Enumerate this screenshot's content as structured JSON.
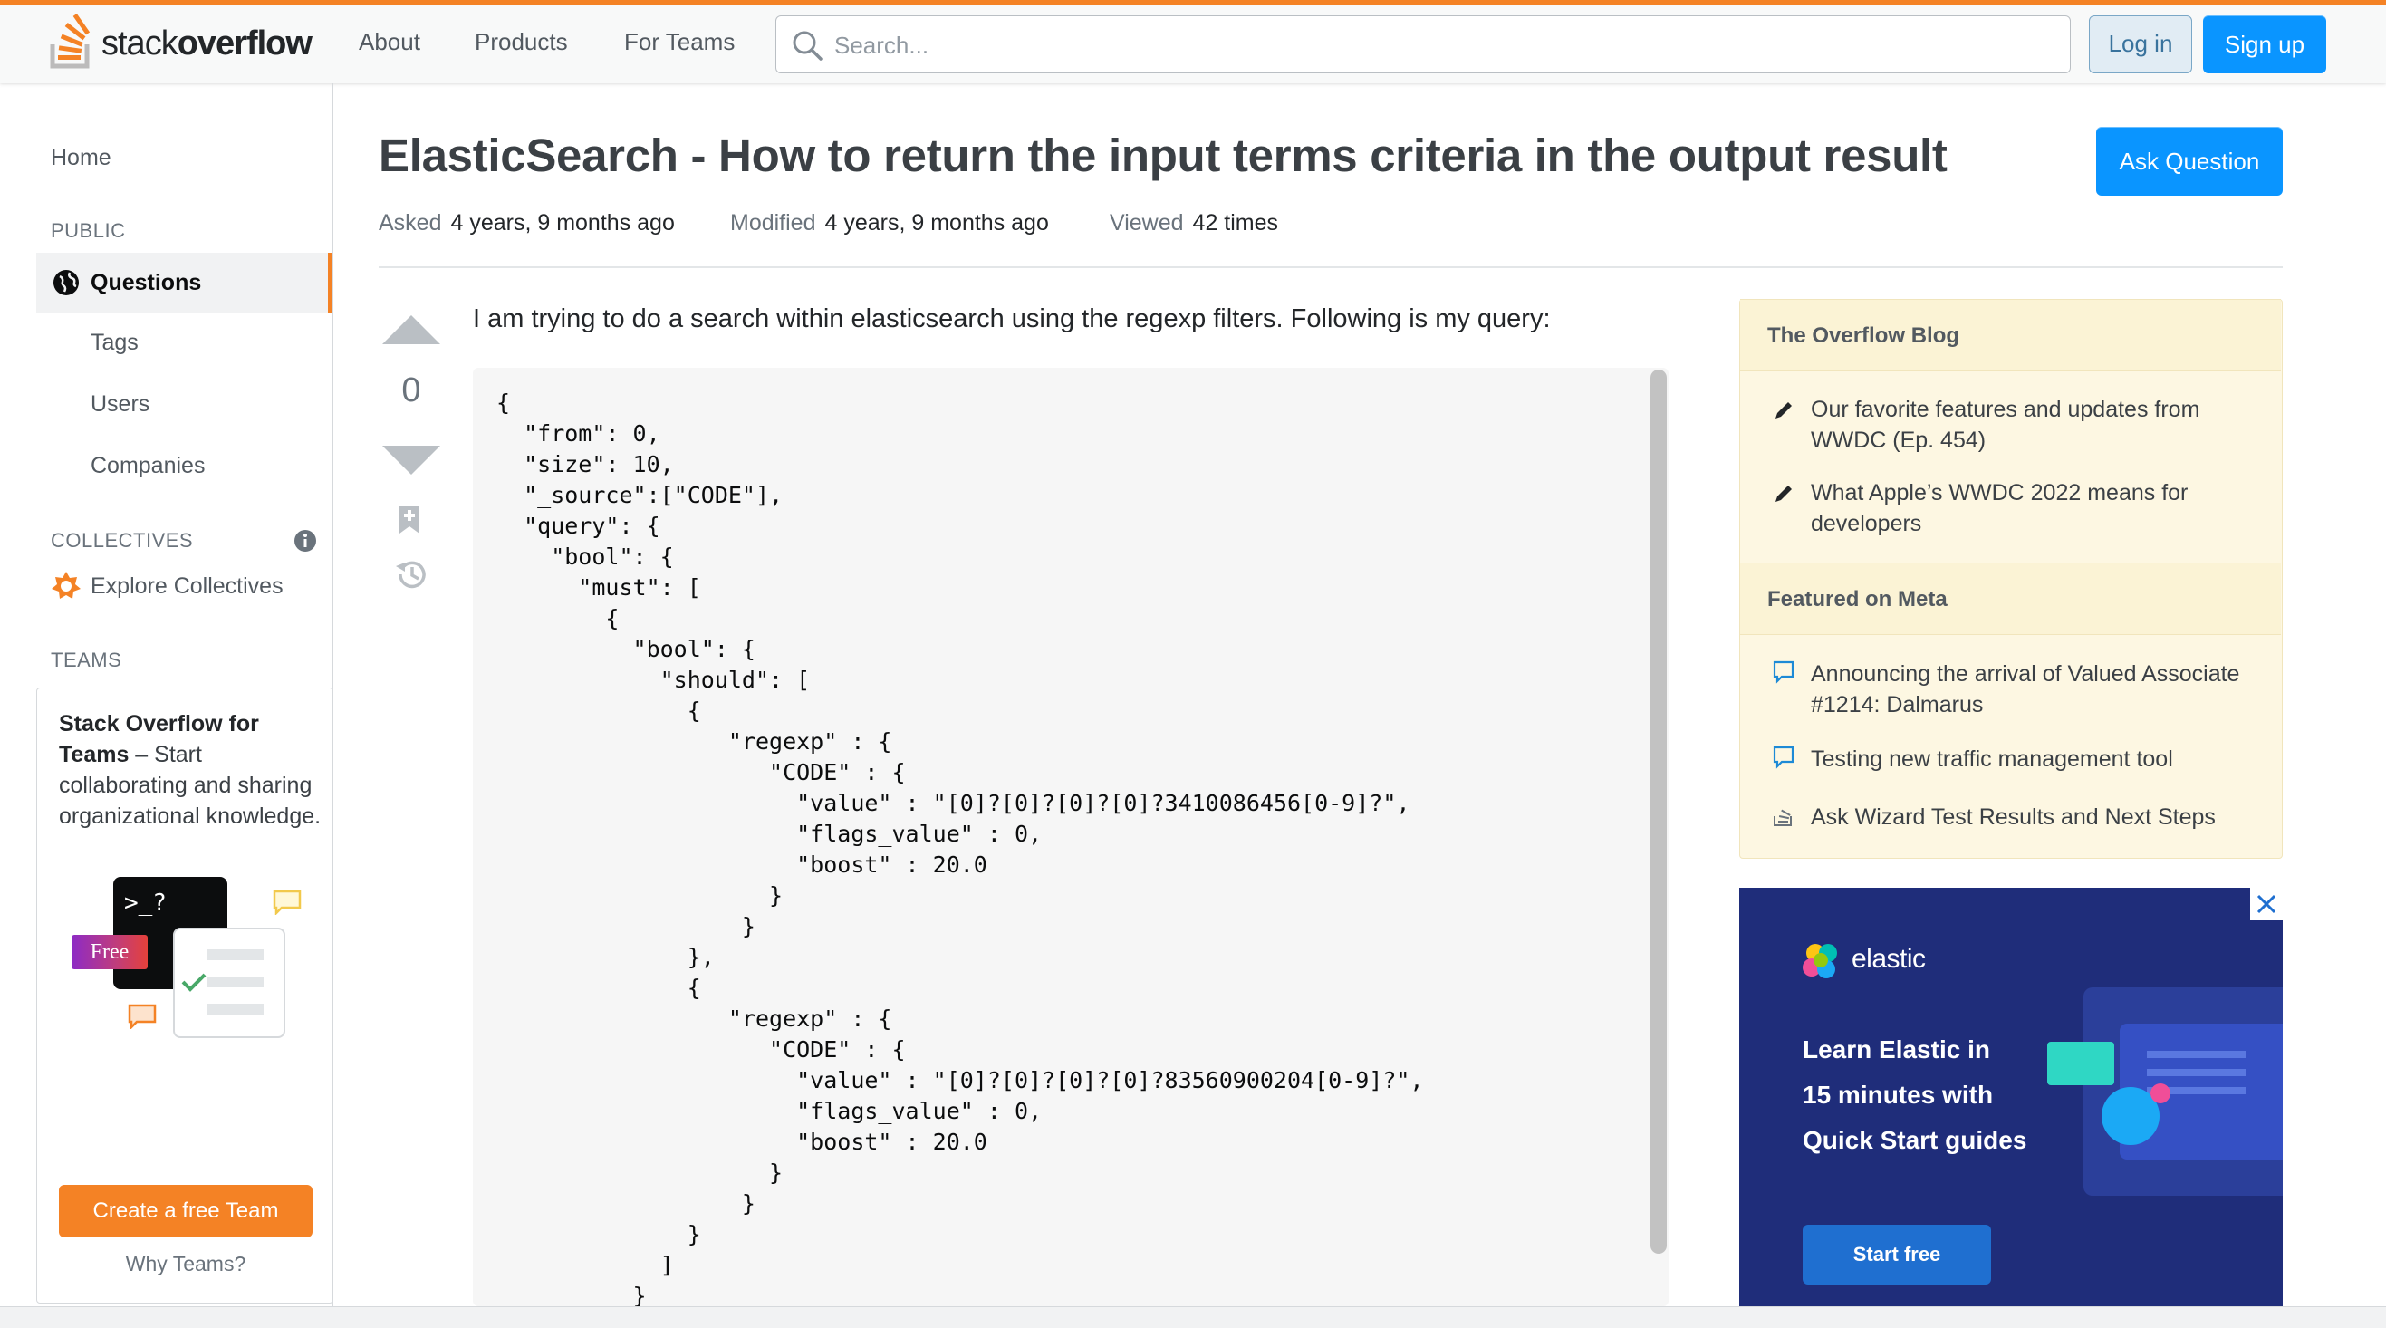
{
  "header": {
    "logo_regular": "stack",
    "logo_bold": "overflow",
    "nav": [
      "About",
      "Products",
      "For Teams"
    ],
    "search_placeholder": "Search...",
    "login_label": "Log in",
    "signup_label": "Sign up"
  },
  "sidebar": {
    "home": "Home",
    "public_label": "PUBLIC",
    "questions": "Questions",
    "tags": "Tags",
    "users": "Users",
    "companies": "Companies",
    "collectives_label": "COLLECTIVES",
    "explore_collectives": "Explore Collectives",
    "teams_label": "TEAMS",
    "teams_box": {
      "title": "Stack Overflow for Teams",
      "description": " – Start collaborating and sharing organizational knowledge.",
      "free_badge": "Free",
      "terminal_text": ">_?",
      "create_button": "Create a free Team",
      "why_link": "Why Teams?"
    }
  },
  "question": {
    "title": "ElasticSearch - How to return the input terms criteria in the output result",
    "ask_button": "Ask Question",
    "asked_label": "Asked",
    "asked_value": "4 years, 9 months ago",
    "modified_label": "Modified",
    "modified_value": "4 years, 9 months ago",
    "viewed_label": "Viewed",
    "viewed_value": "42 times",
    "vote_count": "0",
    "body": "I am trying to do a search within elasticsearch using the regexp filters. Following is my query:",
    "code": "{\n  \"from\": 0,\n  \"size\": 10,\n  \"_source\":[\"CODE\"],\n  \"query\": {\n    \"bool\": {\n      \"must\": [\n        {\n          \"bool\": {\n            \"should\": [\n              {\n                 \"regexp\" : {\n                    \"CODE\" : {\n                      \"value\" : \"[0]?[0]?[0]?[0]?3410086456[0-9]?\",\n                      \"flags_value\" : 0,\n                      \"boost\" : 20.0\n                    }\n                  }\n              },\n              {\n                 \"regexp\" : {\n                    \"CODE\" : {\n                      \"value\" : \"[0]?[0]?[0]?[0]?83560900204[0-9]?\",\n                      \"flags_value\" : 0,\n                      \"boost\" : 20.0\n                    }\n                  }\n              }\n            ]\n          }"
  },
  "right_sidebar": {
    "blog_title": "The Overflow Blog",
    "blog_items": [
      "Our favorite features and updates from WWDC (Ep. 454)",
      "What Apple’s WWDC 2022 means for developers"
    ],
    "meta_title": "Featured on Meta",
    "meta_items": [
      "Announcing the arrival of Valued Associate #1214: Dalmarus",
      "Testing new traffic management tool",
      "Ask Wizard Test Results and Next Steps"
    ]
  },
  "ad": {
    "brand": "elastic",
    "headline_lines": [
      "Learn Elastic in",
      "15 minutes with",
      "Quick Start guides"
    ],
    "button": "Start free"
  },
  "colors": {
    "accent_orange": "#f48225",
    "primary_blue": "#0a95ff",
    "ad_bg": "#1f2d7a",
    "blog_bg": "#fdf7e2"
  }
}
